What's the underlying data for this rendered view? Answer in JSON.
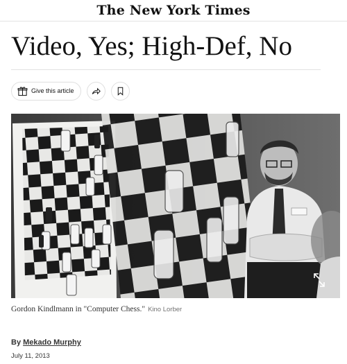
{
  "masthead": {
    "logo_text": "The New York Times"
  },
  "article": {
    "headline": "Video, Yes; High-Def, No",
    "share": {
      "gift_label": "Give this article",
      "gift_icon": "gift-icon",
      "share_icon": "share-arrow-icon",
      "save_icon": "bookmark-icon"
    },
    "image": {
      "caption": "Gordon Kindlmann in \"Computer Chess.\"",
      "credit": "Kino Lorber",
      "expand_icon": "expand-icon"
    },
    "byline": {
      "prefix": "By",
      "author": "Mekado Murphy"
    },
    "date": "July 11, 2013"
  }
}
